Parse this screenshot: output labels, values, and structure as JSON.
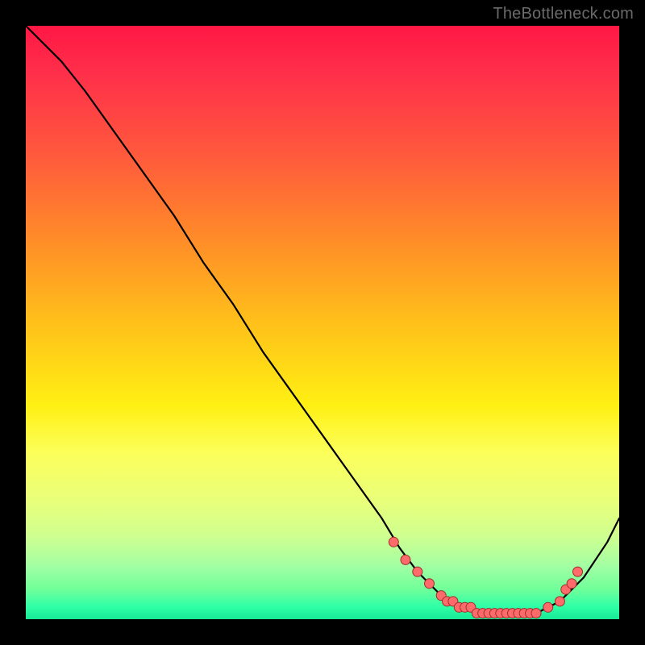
{
  "watermark": "TheBottleneck.com",
  "chart_data": {
    "type": "line",
    "title": "",
    "xlabel": "",
    "ylabel": "",
    "xlim": [
      0,
      100
    ],
    "ylim": [
      0,
      100
    ],
    "grid": false,
    "series": [
      {
        "name": "curve",
        "x": [
          0,
          6,
          10,
          15,
          20,
          25,
          30,
          35,
          40,
          45,
          50,
          55,
          60,
          63,
          66,
          70,
          74,
          78,
          82,
          86,
          90,
          94,
          98,
          100
        ],
        "values": [
          100,
          94,
          89,
          82,
          75,
          68,
          60,
          53,
          45,
          38,
          31,
          24,
          17,
          12,
          8,
          4,
          2,
          1,
          1,
          1,
          3,
          7,
          13,
          17
        ]
      }
    ],
    "points": {
      "name": "markers",
      "x": [
        62,
        64,
        66,
        68,
        70,
        71,
        72,
        73,
        74,
        75,
        76,
        77,
        78,
        79,
        80,
        81,
        82,
        83,
        84,
        85,
        86,
        88,
        90,
        91,
        92,
        93
      ],
      "values": [
        13,
        10,
        8,
        6,
        4,
        3,
        3,
        2,
        2,
        2,
        1,
        1,
        1,
        1,
        1,
        1,
        1,
        1,
        1,
        1,
        1,
        2,
        3,
        5,
        6,
        8
      ]
    },
    "colors": {
      "curve_stroke": "#000000",
      "point_fill": "#ff6b6b",
      "point_stroke": "#a02d2d",
      "bg_top": "#ff1744",
      "bg_mid": "#fff013",
      "bg_bot": "#16e994",
      "frame": "#000000"
    }
  }
}
